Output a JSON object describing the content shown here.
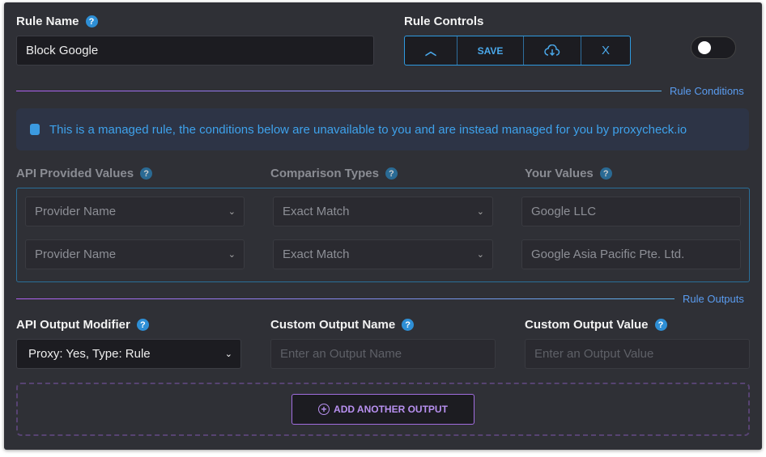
{
  "rule_name": {
    "label": "Rule Name",
    "value": "Block Google"
  },
  "rule_controls": {
    "label": "Rule Controls",
    "save": "SAVE",
    "close": "X",
    "toggle_on": false
  },
  "conditions": {
    "section": "Rule Conditions",
    "notice": "This is a managed rule, the conditions below are unavailable to you and are instead managed for you by proxycheck.io",
    "headers": [
      "API Provided Values",
      "Comparison Types",
      "Your Values"
    ],
    "rows": [
      {
        "api": "Provider Name",
        "comparison": "Exact Match",
        "value": "Google LLC"
      },
      {
        "api": "Provider Name",
        "comparison": "Exact Match",
        "value": "Google Asia Pacific Pte. Ltd."
      }
    ]
  },
  "outputs": {
    "section": "Rule Outputs",
    "modifier_label": "API Output Modifier",
    "modifier_value": "Proxy: Yes, Type: Rule",
    "name_label": "Custom Output Name",
    "name_placeholder": "Enter an Output Name",
    "value_label": "Custom Output Value",
    "value_placeholder": "Enter an Output Value",
    "add_button": "ADD ANOTHER OUTPUT"
  }
}
